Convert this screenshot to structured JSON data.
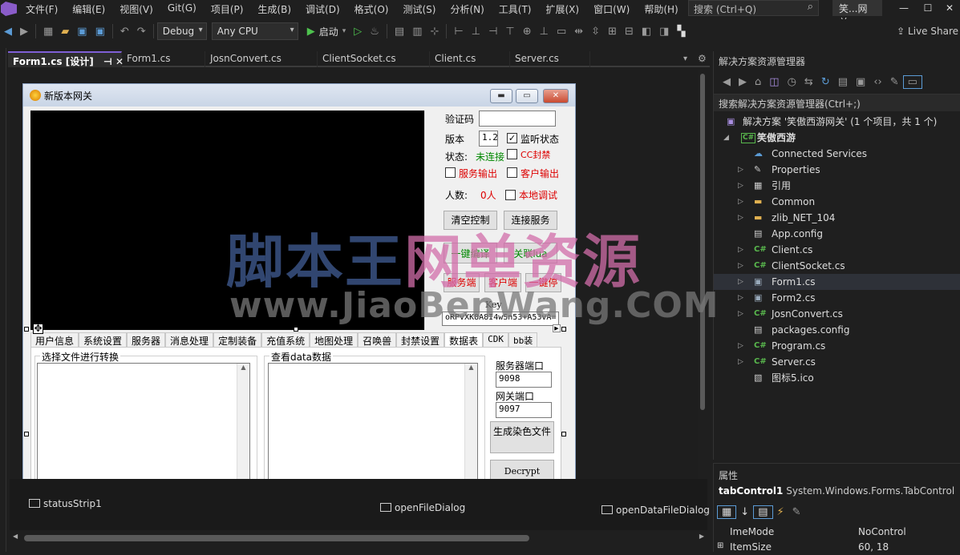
{
  "menubar": {
    "items": [
      "文件(F)",
      "编辑(E)",
      "视图(V)",
      "Git(G)",
      "项目(P)",
      "生成(B)",
      "调试(D)",
      "格式(O)",
      "测试(S)",
      "分析(N)",
      "工具(T)",
      "扩展(X)",
      "窗口(W)",
      "帮助(H)"
    ],
    "search_placeholder": "搜索 (Ctrl+Q)",
    "solution_name": "笑...网关"
  },
  "toolbar": {
    "config": "Debug",
    "platform": "Any CPU",
    "start_label": "启动",
    "liveshare_label": "Live Share"
  },
  "doc_tabs": [
    "Form1.cs [设计]",
    "Form1.cs",
    "JosnConvert.cs",
    "ClientSocket.cs",
    "Client.cs",
    "Server.cs"
  ],
  "form": {
    "title": "新版本网关",
    "verify_label": "验证码",
    "version_label": "版本",
    "version_value": "1.2",
    "listen_label": "监听状态",
    "status_label": "状态:",
    "status_value": "未连接",
    "cc_label": "CC封禁",
    "service_output_label": "服务输出",
    "client_output_label": "客户输出",
    "people_label": "人数:",
    "people_value": "0人",
    "local_debug_label": "本地调试",
    "clear_btn": "清空控制",
    "connect_btn": "连接服务",
    "compile_btn": "一键编译",
    "lua_btn": "关联lua",
    "server_btn": "服务端",
    "client_btn": "客户端",
    "stop_btn": "一键停",
    "key_label": "Key",
    "key_value": "oRPvXK8A8I4wSn53+A53vA=",
    "tabs": [
      "用户信息",
      "系统设置",
      "服务器",
      "消息处理",
      "定制装备",
      "充值系统",
      "地图处理",
      "召唤兽",
      "封禁设置",
      "数据表",
      "CDK",
      "bb装"
    ],
    "group_convert": "选择文件进行转换",
    "group_data": "查看data数据",
    "server_port_label": "服务器端口",
    "server_port_value": "9098",
    "gateway_port_label": "网关端口",
    "gateway_port_value": "9097",
    "gen_dye_btn": "生成染色文件",
    "decrypt_btn": "Decrypt"
  },
  "tray": {
    "status_strip": "statusStrip1",
    "open_file": "openFileDialog",
    "open_data": "openDataFileDialog"
  },
  "solution_explorer": {
    "title": "解决方案资源管理器",
    "search": "搜索解决方案资源管理器(Ctrl+;)",
    "solution": "解决方案 '笑傲西游网关' (1 个项目，共 1 个)",
    "project": "笑傲西游",
    "items": [
      {
        "label": "Connected Services",
        "icon": "connected-services-icon",
        "arrow": false
      },
      {
        "label": "Properties",
        "icon": "wrench-icon",
        "arrow": true
      },
      {
        "label": "引用",
        "icon": "references-icon",
        "arrow": true
      },
      {
        "label": "Common",
        "icon": "folder-icon",
        "arrow": true
      },
      {
        "label": "zlib_NET_104",
        "icon": "folder-icon",
        "arrow": true
      },
      {
        "label": "App.config",
        "icon": "config-icon",
        "arrow": false
      },
      {
        "label": "Client.cs",
        "icon": "csharp-icon",
        "arrow": true
      },
      {
        "label": "ClientSocket.cs",
        "icon": "csharp-icon",
        "arrow": true
      },
      {
        "label": "Form1.cs",
        "icon": "form-icon",
        "arrow": true
      },
      {
        "label": "Form2.cs",
        "icon": "form-icon",
        "arrow": true
      },
      {
        "label": "JosnConvert.cs",
        "icon": "csharp-icon",
        "arrow": true
      },
      {
        "label": "packages.config",
        "icon": "config-icon",
        "arrow": false
      },
      {
        "label": "Program.cs",
        "icon": "csharp-icon",
        "arrow": true
      },
      {
        "label": "Server.cs",
        "icon": "csharp-icon",
        "arrow": true
      },
      {
        "label": "图标5.ico",
        "icon": "image-icon",
        "arrow": false
      }
    ]
  },
  "properties": {
    "title": "属性",
    "object_name": "tabControl1",
    "object_type": "System.Windows.Forms.TabControl",
    "rows": [
      {
        "name": "ImeMode",
        "value": "NoControl"
      },
      {
        "name": "ItemSize",
        "value": "60, 18"
      }
    ]
  },
  "watermark": {
    "line1_blue_a": "脚本王",
    "line1_pink": "网单",
    "line1_blue_b": "资源",
    "line2": "www.JiaoBenWang.COM"
  },
  "colors": {
    "accent": "#7f5fd6",
    "highlight": "#2e3138",
    "csharp": "#59b84d"
  }
}
